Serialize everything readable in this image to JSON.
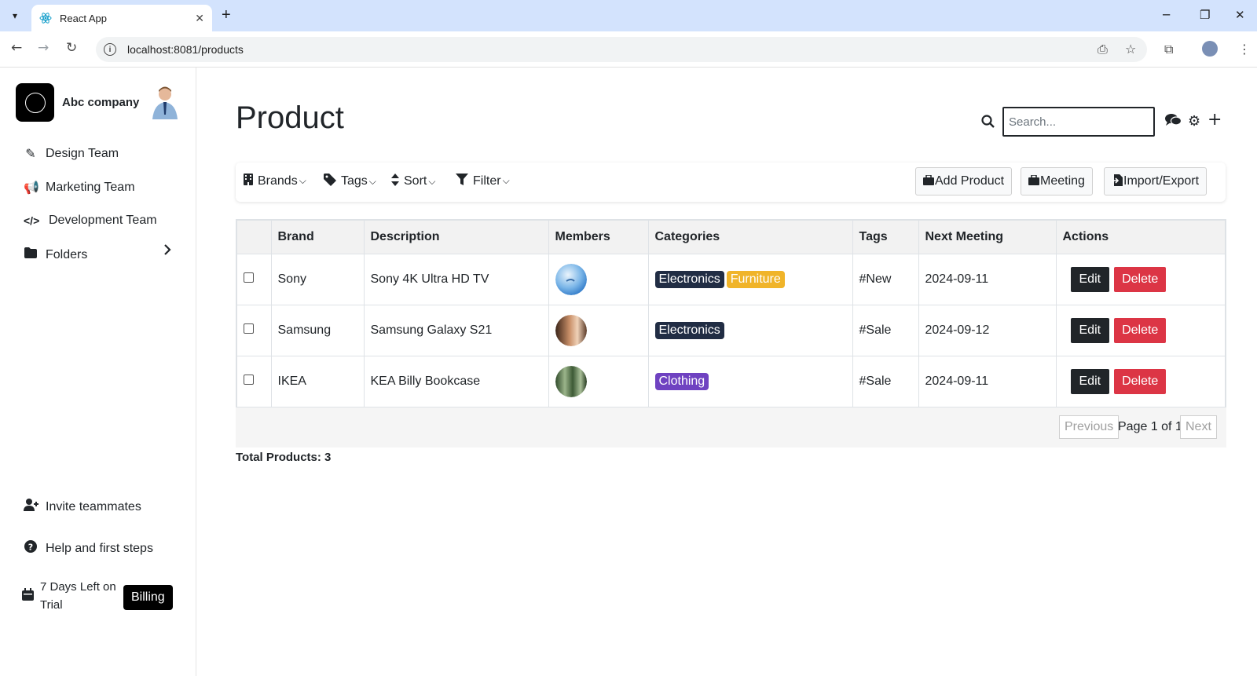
{
  "browser": {
    "tab_title": "React App",
    "url": "localhost:8081/products"
  },
  "sidebar": {
    "company": "Abc company",
    "items": [
      {
        "label": "Design Team",
        "icon": "design-icon"
      },
      {
        "label": "Marketing Team",
        "icon": "megaphone-icon"
      },
      {
        "label": "Development Team",
        "icon": "code-icon"
      },
      {
        "label": "Folders",
        "icon": "folder-icon"
      }
    ],
    "invite": "Invite teammates",
    "help": "Help and first steps",
    "trial": "7 Days Left on Trial",
    "billing": "Billing"
  },
  "main": {
    "title": "Product",
    "search_placeholder": "Search...",
    "toolbar": {
      "brands": "Brands",
      "tags": "Tags",
      "sort": "Sort",
      "filter": "Filter",
      "add_product": "Add Product",
      "meeting": "Meeting",
      "import_export": "Import/Export"
    },
    "table": {
      "headers": [
        "",
        "Brand",
        "Description",
        "Members",
        "Categories",
        "Tags",
        "Next Meeting",
        "Actions"
      ],
      "rows": [
        {
          "brand": "Sony",
          "description": "Sony 4K Ultra HD TV",
          "categories": [
            "Electronics",
            "Furniture"
          ],
          "tag": "#New",
          "meeting": "2024-09-11"
        },
        {
          "brand": "Samsung",
          "description": "Samsung Galaxy S21",
          "categories": [
            "Electronics"
          ],
          "tag": "#Sale",
          "meeting": "2024-09-12"
        },
        {
          "brand": "IKEA",
          "description": "KEA Billy Bookcase",
          "categories": [
            "Clothing"
          ],
          "tag": "#Sale",
          "meeting": "2024-09-11"
        }
      ],
      "edit_label": "Edit",
      "delete_label": "Delete"
    },
    "pager": {
      "previous": "Previous",
      "page_text": "Page 1 of 1",
      "next": "Next"
    },
    "total": "Total Products: 3"
  },
  "colors": {
    "badge_dark": "#212d44",
    "badge_yellow": "#f0b429",
    "badge_purple": "#6f42c1",
    "delete_red": "#dc3545",
    "tabbar": "#d3e3fd"
  }
}
